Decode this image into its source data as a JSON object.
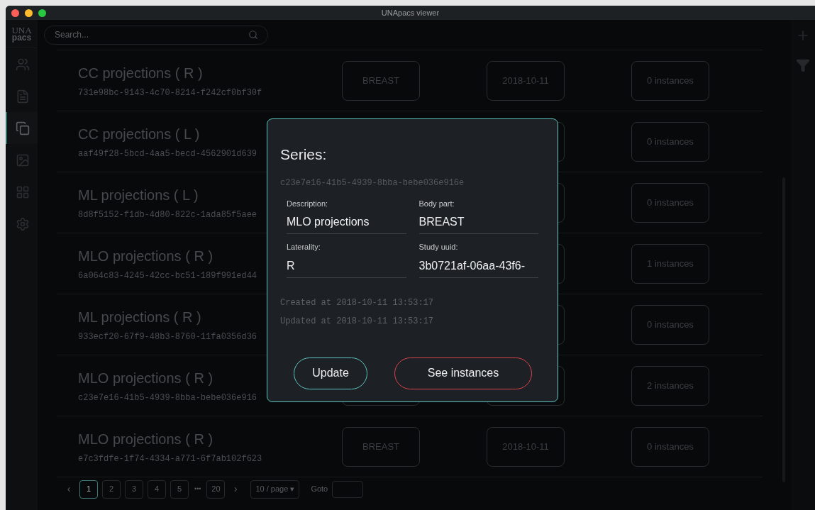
{
  "window": {
    "title": "UNApacs viewer"
  },
  "logo": {
    "line_1": "UNA",
    "line_2": "pacs"
  },
  "search": {
    "placeholder": "Search..."
  },
  "sidebar": {
    "items": [
      {
        "kind": "users",
        "selected": false
      },
      {
        "kind": "document",
        "selected": false
      },
      {
        "kind": "copies",
        "selected": true
      },
      {
        "kind": "image",
        "selected": false
      },
      {
        "kind": "grid",
        "selected": false
      },
      {
        "kind": "settings",
        "selected": false
      }
    ]
  },
  "series": [
    {
      "title": "CC projections ( R )",
      "uuid": "731e98bc-9143-4c70-8214-f242cf0bf30f",
      "body_part": "BREAST",
      "date": "2018-10-11",
      "instances": "0 instances"
    },
    {
      "title": "CC projections ( L )",
      "uuid": "aaf49f28-5bcd-4aa5-becd-4562901d639",
      "instances": "0 instances"
    },
    {
      "title": "ML projections ( L )",
      "uuid": "8d8f5152-f1db-4d80-822c-1ada85f5aee",
      "instances": "0 instances"
    },
    {
      "title": "MLO projections ( R )",
      "uuid": "6a064c83-4245-42cc-bc51-189f991ed44",
      "instances": "1 instances"
    },
    {
      "title": "ML projections ( R )",
      "uuid": "933ecf20-67f9-48b3-8760-11fa0356d36",
      "instances": "0 instances"
    },
    {
      "title": "MLO projections ( R )",
      "uuid": "c23e7e16-41b5-4939-8bba-bebe036e916",
      "instances": "2 instances"
    },
    {
      "title": "MLO projections ( R )",
      "uuid": "e7c3fdfe-1f74-4334-a771-6f7ab102f623",
      "body_part": "BREAST",
      "date": "2018-10-11",
      "instances": "0 instances"
    }
  ],
  "pagination": {
    "prev": "‹",
    "pages": [
      {
        "label": "1",
        "selected": true
      },
      {
        "label": "2",
        "selected": false
      },
      {
        "label": "3",
        "selected": false
      },
      {
        "label": "4",
        "selected": false
      },
      {
        "label": "5",
        "selected": false
      }
    ],
    "ellipsis": "•••",
    "last": {
      "label": "20",
      "selected": false
    },
    "next": "›",
    "page_size": "10 / page ▾",
    "goto_label": "Goto"
  },
  "dialog": {
    "title": "Series:",
    "uuid": "c23e7e16-41b5-4939-8bba-bebe036e916e",
    "fields": [
      {
        "label": "Description:",
        "value": "MLO projections"
      },
      {
        "label": "Body part:",
        "value": "BREAST"
      },
      {
        "label": "Laterality:",
        "value": "R"
      },
      {
        "label": "Study uuid:",
        "value": "3b0721af-06aa-43f6-"
      }
    ],
    "created": "Created at 2018-10-11 13:53:17",
    "updated": "Updated at 2018-10-11 13:53:17",
    "buttons": [
      {
        "kind": "secondary",
        "label": "Update"
      },
      {
        "kind": "primary",
        "label": "See instances"
      }
    ]
  }
}
